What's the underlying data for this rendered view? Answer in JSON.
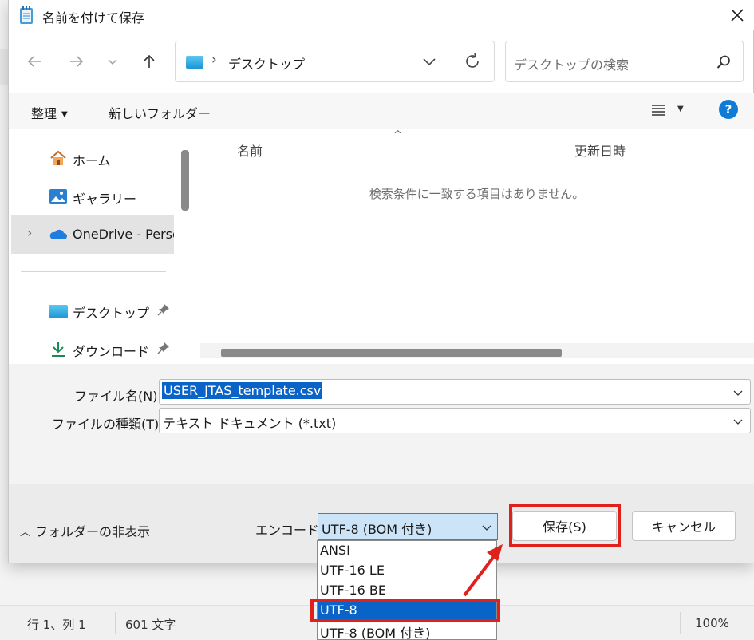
{
  "background_app": {
    "statusbar": {
      "position": "行 1、列 1",
      "chars": "601 文字",
      "zoom": "100%"
    }
  },
  "dialog": {
    "title": "名前を付けて保存",
    "nav": {
      "back_icon": "arrow-left-icon",
      "forward_icon": "arrow-right-icon",
      "recent_icon": "chevron-down-icon",
      "up_icon": "arrow-up-icon"
    },
    "address": {
      "current": "デスクトップ"
    },
    "search": {
      "placeholder": "デスクトップの検索"
    },
    "toolbar": {
      "organize": "整理",
      "new_folder": "新しいフォルダー"
    },
    "nav_pane": {
      "items": [
        {
          "label": "ホーム",
          "icon": "home-icon"
        },
        {
          "label": "ギャラリー",
          "icon": "gallery-icon"
        },
        {
          "label": "OneDrive - Personal",
          "icon": "onedrive-cloud-icon"
        },
        {
          "label": "デスクトップ",
          "icon": "desktop-folder-icon",
          "pinned": true
        },
        {
          "label": "ダウンロード",
          "icon": "download-icon",
          "pinned": true
        }
      ]
    },
    "file_list": {
      "columns": [
        "名前",
        "更新日時"
      ],
      "empty_message": "検索条件に一致する項目はありません。"
    },
    "file_name": {
      "label": "ファイル名(N):",
      "value": "USER_JTAS_template.csv"
    },
    "file_type": {
      "label": "ファイルの種類(T):",
      "value": "テキスト ドキュメント (*.txt)"
    },
    "hide_folders": "フォルダーの非表示",
    "encoding": {
      "label": "エンコード:",
      "selected": "UTF-8 (BOM 付き)",
      "options": [
        "ANSI",
        "UTF-16 LE",
        "UTF-16 BE",
        "UTF-8",
        "UTF-8 (BOM 付き)"
      ],
      "highlighted": "UTF-8"
    },
    "buttons": {
      "save": "保存(S)",
      "cancel": "キャンセル"
    },
    "annotation_color": "#e0201b"
  }
}
